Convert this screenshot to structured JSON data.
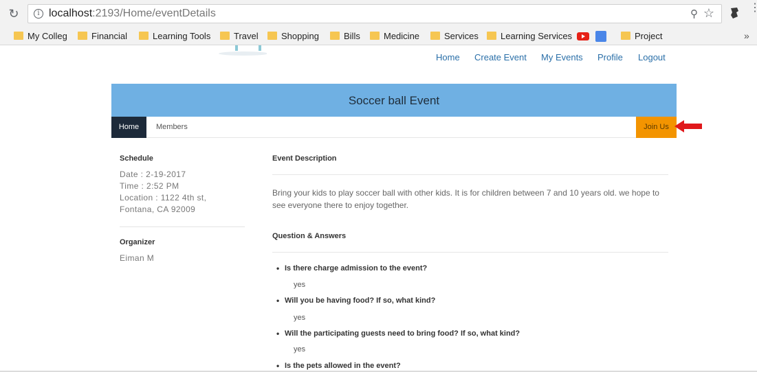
{
  "browser": {
    "url_host": "localhost",
    "url_path": ":2193/Home/eventDetails",
    "reload_icon": "reload-icon",
    "bookmarks": [
      "My Colleg",
      "Financial",
      "Learning Tools",
      "Travel",
      "Shopping",
      "Bills",
      "Medicine",
      "Services",
      "Learning Services",
      "Project"
    ],
    "more": "»"
  },
  "nav": {
    "home": "Home",
    "create_event": "Create Event",
    "my_events": "My Events",
    "profile": "Profile",
    "logout": "Logout"
  },
  "event": {
    "title": "Soccer ball Event",
    "tabs": {
      "home": "Home",
      "members": "Members"
    },
    "join_label": "Join Us"
  },
  "schedule": {
    "heading": "Schedule",
    "date": "Date : 2-19-2017",
    "time": "Time : 2:52 PM",
    "location_line1": "Location : 1122 4th st,",
    "location_line2": "Fontana, CA 92009"
  },
  "organizer": {
    "heading": "Organizer",
    "name": "Eiman M"
  },
  "description": {
    "heading": "Event Description",
    "text": "Bring your kids to play soccer ball with other kids. It is for children between 7 and 10 years old. we hope to see everyone there to enjoy together."
  },
  "qa": {
    "heading": "Question & Answers",
    "items": [
      {
        "q": "Is there charge admission to the event?",
        "a": "yes"
      },
      {
        "q": "Will you be having food? If so, what kind?",
        "a": "yes"
      },
      {
        "q": "Will the participating guests need to bring food? If so, what kind?",
        "a": "yes"
      },
      {
        "q": "Is the pets allowed in the event?",
        "a": ""
      }
    ]
  },
  "colors": {
    "hero": "#6fb0e3",
    "home_tab": "#1d2a3a",
    "join": "#f39400",
    "arrow": "#e0181b"
  }
}
